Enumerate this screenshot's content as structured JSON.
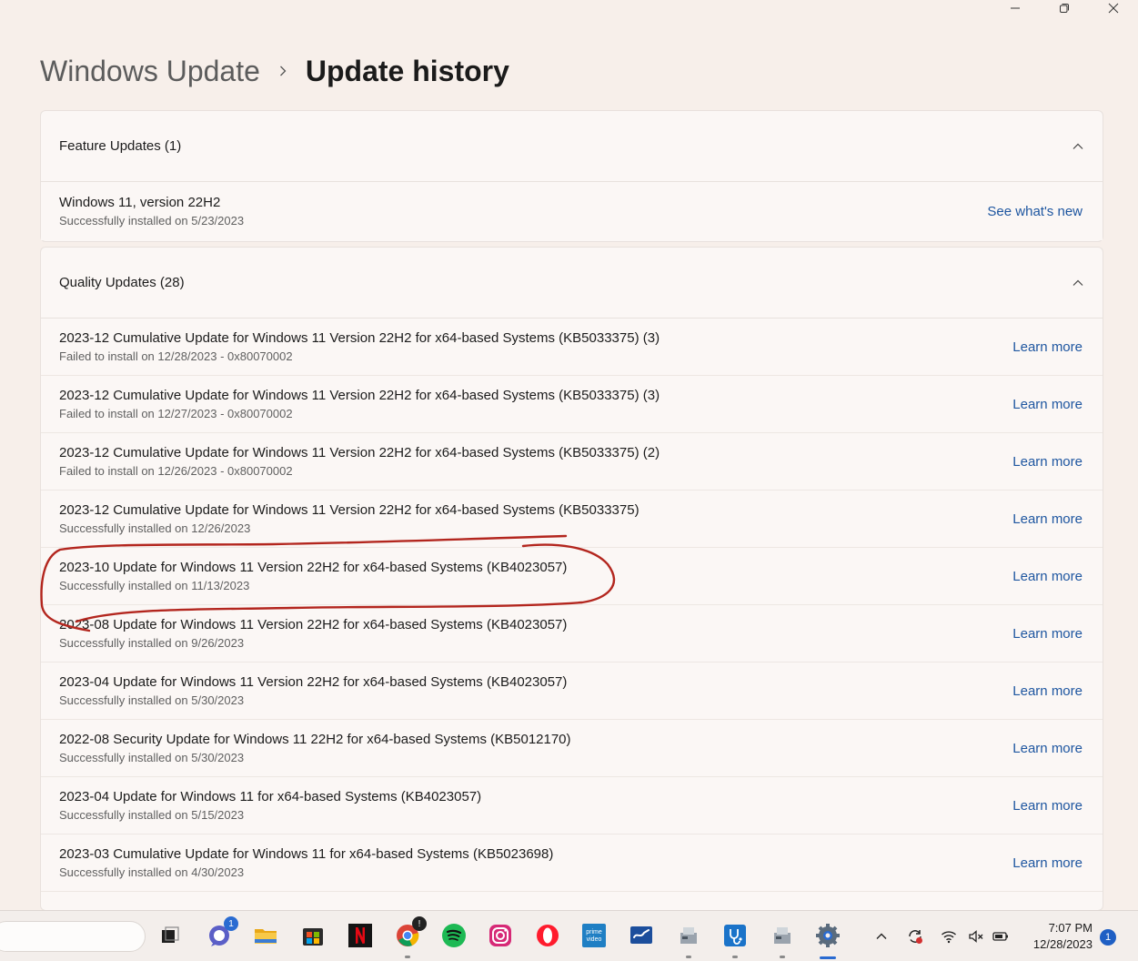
{
  "breadcrumb": {
    "parent": "Windows Update",
    "current": "Update history"
  },
  "feature_updates": {
    "header": "Feature Updates (1)",
    "items": [
      {
        "title": "Windows 11, version 22H2",
        "status": "Successfully installed on 5/23/2023",
        "link": "See what's new"
      }
    ]
  },
  "quality_updates": {
    "header": "Quality Updates (28)",
    "items": [
      {
        "title": "2023-12 Cumulative Update for Windows 11 Version 22H2 for x64-based Systems (KB5033375) (3)",
        "status": "Failed to install on 12/28/2023 - 0x80070002",
        "link": "Learn more"
      },
      {
        "title": "2023-12 Cumulative Update for Windows 11 Version 22H2 for x64-based Systems (KB5033375) (3)",
        "status": "Failed to install on 12/27/2023 - 0x80070002",
        "link": "Learn more"
      },
      {
        "title": "2023-12 Cumulative Update for Windows 11 Version 22H2 for x64-based Systems (KB5033375) (2)",
        "status": "Failed to install on 12/26/2023 - 0x80070002",
        "link": "Learn more"
      },
      {
        "title": "2023-12 Cumulative Update for Windows 11 Version 22H2 for x64-based Systems (KB5033375)",
        "status": "Successfully installed on 12/26/2023",
        "link": "Learn more"
      },
      {
        "title": "2023-10 Update for Windows 11 Version 22H2 for x64-based Systems (KB4023057)",
        "status": "Successfully installed on 11/13/2023",
        "link": "Learn more"
      },
      {
        "title": "2023-08 Update for Windows 11 Version 22H2 for x64-based Systems (KB4023057)",
        "status": "Successfully installed on 9/26/2023",
        "link": "Learn more"
      },
      {
        "title": "2023-04 Update for Windows 11 Version 22H2 for x64-based Systems (KB4023057)",
        "status": "Successfully installed on 5/30/2023",
        "link": "Learn more"
      },
      {
        "title": "2022-08 Security Update for Windows 11 22H2 for x64-based Systems (KB5012170)",
        "status": "Successfully installed on 5/30/2023",
        "link": "Learn more"
      },
      {
        "title": "2023-04 Update for Windows 11 for x64-based Systems (KB4023057)",
        "status": "Successfully installed on 5/15/2023",
        "link": "Learn more"
      },
      {
        "title": "2023-03 Cumulative Update for Windows 11 for x64-based Systems (KB5023698)",
        "status": "Successfully installed on 4/30/2023",
        "link": "Learn more"
      }
    ]
  },
  "taskbar": {
    "chat_badge": "1",
    "chrome_badge": "!",
    "prime_label_top": "prime",
    "prime_label_bottom": "video",
    "clock_time": "7:07 PM",
    "clock_date": "12/28/2023",
    "notification_count": "1"
  },
  "colors": {
    "accent": "#1e56a0",
    "annotation": "#b3261e"
  },
  "icons": [
    "minimize-icon",
    "maximize-icon",
    "close-icon",
    "chevron-right-icon",
    "chevron-up-icon"
  ]
}
